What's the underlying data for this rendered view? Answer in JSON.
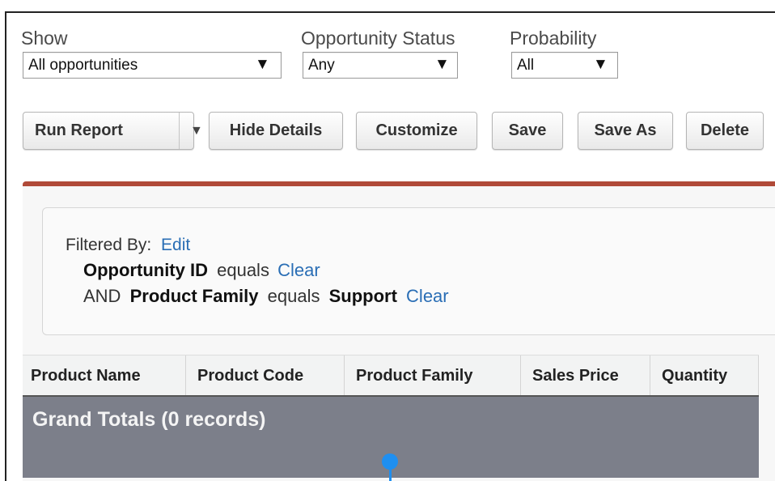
{
  "filters": {
    "show": {
      "label": "Show",
      "value": "All opportunities"
    },
    "status": {
      "label": "Opportunity Status",
      "value": "Any"
    },
    "probability": {
      "label": "Probability",
      "value": "All"
    },
    "arrow": "▼"
  },
  "toolbar": {
    "run_report": "Run Report",
    "run_dropdown": "▼",
    "hide_details": "Hide Details",
    "customize": "Customize",
    "save": "Save",
    "save_as": "Save As",
    "delete": "Delete"
  },
  "filtered_by": {
    "label": "Filtered By:",
    "edit": "Edit",
    "line1_field": "Opportunity ID",
    "line1_op": "equals",
    "line1_clear": "Clear",
    "line2_and": "AND",
    "line2_field": "Product Family",
    "line2_op": "equals",
    "line2_value": "Support",
    "line2_clear": "Clear"
  },
  "table": {
    "columns": [
      "Product Name",
      "Product Code",
      "Product Family",
      "Sales Price",
      "Quantity"
    ],
    "grand_totals": "Grand Totals (0 records)"
  },
  "colors": {
    "accent_rule": "#b04a38",
    "link": "#2a6eb5",
    "totals_bg": "#7c7f8a",
    "cursor": "#1f8ff0"
  }
}
